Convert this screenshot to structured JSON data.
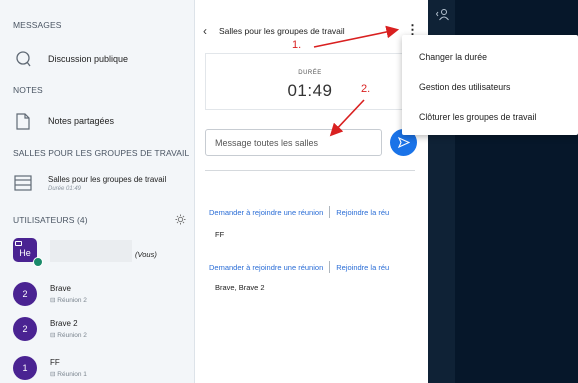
{
  "sidebar": {
    "messages_title": "MESSAGES",
    "public_chat_label": "Discussion publique",
    "notes_title": "NOTES",
    "shared_notes_label": "Notes partagées",
    "breakout_title": "SALLES POUR LES GROUPES DE TRAVAIL",
    "breakout_item_label": "Salles pour les groupes de travail",
    "breakout_item_sub": "Durée 01:49",
    "users_title": "UTILISATEURS (4)",
    "me": {
      "initials": "He",
      "tag": "(Vous)"
    },
    "users": [
      {
        "initials": "2",
        "name": "Brave",
        "room": "Réunion 2"
      },
      {
        "initials": "2",
        "name": "Brave 2",
        "room": "Réunion 2"
      },
      {
        "initials": "1",
        "name": "FF",
        "room": "Réunion 1"
      }
    ]
  },
  "panel": {
    "back_glyph": "‹",
    "title": "Salles pour les groupes de travail",
    "kebab_glyph": "⋮",
    "duree_label": "DURÉE",
    "duree_value": "01:49",
    "message_placeholder": "Message toutes les salles",
    "rooms": [
      {
        "join_label": "Demander à rejoindre une réunion",
        "join_audio_label": "Rejoindre la réu",
        "users": "FF"
      },
      {
        "join_label": "Demander à rejoindre une réunion",
        "join_audio_label": "Rejoindre la réu",
        "users": "Brave, Brave 2"
      }
    ]
  },
  "menu": {
    "items": [
      "Changer la durée",
      "Gestion des utilisateurs",
      "Clôturer les groupes de travail"
    ]
  },
  "annotations": {
    "step1": "1.",
    "step2": "2.",
    "color": "#d92020"
  },
  "icons": {
    "public_chat": "chat-bubble-icon",
    "shared_notes": "notes-page-icon",
    "breakout": "breakout-rooms-icon",
    "users_settings": "gear-icon",
    "send": "send-arrow-icon",
    "room": "door-icon",
    "people": "people-icon"
  },
  "colors": {
    "accent": "#1a73e8",
    "avatar": "#4a2392",
    "link": "#2a6dd6",
    "dark_bg": "#06172a"
  }
}
